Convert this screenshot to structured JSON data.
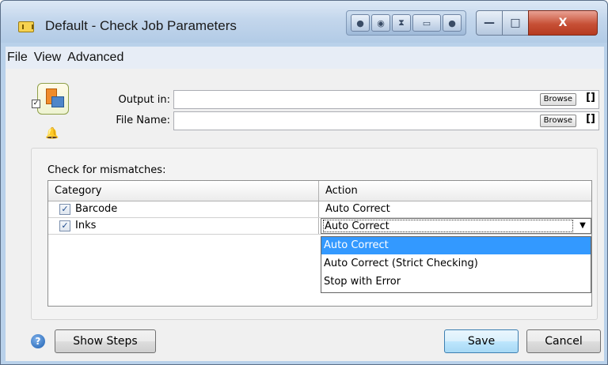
{
  "window": {
    "title": "Default - Check Job Parameters",
    "caption_buttons": {
      "minimize": "—",
      "maximize": "□",
      "close": "X"
    }
  },
  "menu": {
    "items": [
      "File",
      "View",
      "Advanced"
    ]
  },
  "fields": {
    "output_in": {
      "label": "Output in:",
      "value": "",
      "browse": "Browse",
      "bracket": "[]"
    },
    "file_name": {
      "label": "File Name:",
      "value": "",
      "browse": "Browse",
      "bracket": "[]"
    }
  },
  "mismatch": {
    "label": "Check for mismatches:",
    "columns": [
      "Category",
      "Action"
    ],
    "rows": [
      {
        "category": "Barcode",
        "checked": true,
        "action": "Auto Correct"
      },
      {
        "category": "Inks",
        "checked": true,
        "action": "Auto Correct"
      }
    ],
    "dropdown_options": [
      "Auto Correct",
      "Auto Correct (Strict Checking)",
      "Stop with Error"
    ],
    "selected_option": "Auto Correct"
  },
  "footer": {
    "show_steps": "Show Steps",
    "save": "Save",
    "cancel": "Cancel"
  },
  "colors": {
    "selection": "#3399ff",
    "close_button": "#c75036"
  }
}
